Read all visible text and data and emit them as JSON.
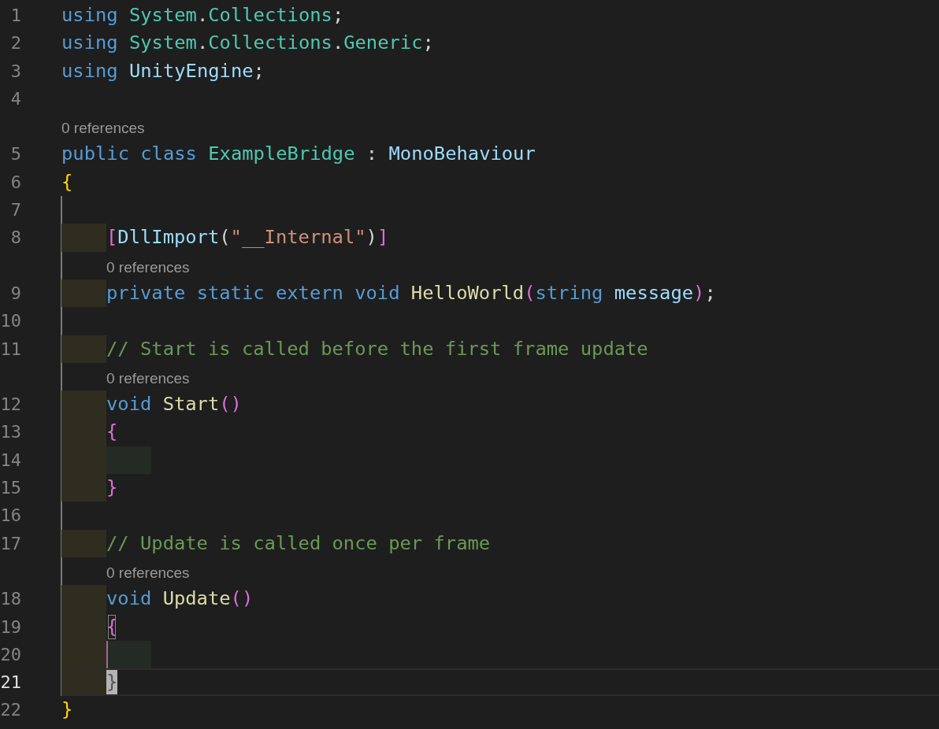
{
  "lines": [
    {
      "kind": "code",
      "number": "1",
      "guide": false,
      "current": false,
      "tokens": [
        {
          "text": "using ",
          "kind": "keyword"
        },
        {
          "text": "System",
          "kind": "type"
        },
        {
          "text": ".",
          "kind": "plain"
        },
        {
          "text": "Collections",
          "kind": "type"
        },
        {
          "text": ";",
          "kind": "plain"
        }
      ]
    },
    {
      "kind": "code",
      "number": "2",
      "guide": false,
      "current": false,
      "tokens": [
        {
          "text": "using ",
          "kind": "keyword"
        },
        {
          "text": "System",
          "kind": "type"
        },
        {
          "text": ".",
          "kind": "plain"
        },
        {
          "text": "Collections",
          "kind": "type"
        },
        {
          "text": ".",
          "kind": "plain"
        },
        {
          "text": "Generic",
          "kind": "type"
        },
        {
          "text": ";",
          "kind": "plain"
        }
      ]
    },
    {
      "kind": "code",
      "number": "3",
      "guide": false,
      "current": false,
      "tokens": [
        {
          "text": "using ",
          "kind": "keyword"
        },
        {
          "text": "UnityEngine",
          "kind": "ident"
        },
        {
          "text": ";",
          "kind": "plain"
        }
      ]
    },
    {
      "kind": "code",
      "number": "4",
      "guide": false,
      "current": false
    },
    {
      "kind": "lens",
      "text": "0 references",
      "nested": false,
      "guide": false
    },
    {
      "kind": "code",
      "number": "5",
      "guide": false,
      "current": false,
      "tokens": [
        {
          "text": "public ",
          "kind": "keyword"
        },
        {
          "text": "class ",
          "kind": "keyword"
        },
        {
          "text": "ExampleBridge",
          "kind": "type"
        },
        {
          "text": " : ",
          "kind": "plain"
        },
        {
          "text": "MonoBehaviour",
          "kind": "ident"
        }
      ]
    },
    {
      "kind": "code",
      "number": "6",
      "guide": false,
      "current": false,
      "tokens": [
        {
          "text": "{",
          "kind": "brace"
        }
      ]
    },
    {
      "kind": "code",
      "number": "7",
      "guide": true,
      "current": false
    },
    {
      "kind": "code",
      "number": "8",
      "guide": true,
      "current": false,
      "indents": [
        {
          "kind": "block"
        }
      ],
      "tokens": [
        {
          "text": "[",
          "kind": "paren"
        },
        {
          "text": "DllImport",
          "kind": "ident"
        },
        {
          "text": "(",
          "kind": "plain"
        },
        {
          "text": "\"__Internal\"",
          "kind": "string"
        },
        {
          "text": ")",
          "kind": "plain"
        },
        {
          "text": "]",
          "kind": "paren"
        }
      ]
    },
    {
      "kind": "lens",
      "text": "0 references",
      "nested": true,
      "guide": true
    },
    {
      "kind": "code",
      "number": "9",
      "guide": true,
      "current": false,
      "indents": [
        {
          "kind": "block"
        }
      ],
      "tokens": [
        {
          "text": "private ",
          "kind": "keyword"
        },
        {
          "text": "static ",
          "kind": "keyword"
        },
        {
          "text": "extern ",
          "kind": "keyword"
        },
        {
          "text": "void ",
          "kind": "keyword"
        },
        {
          "text": "HelloWorld",
          "kind": "method"
        },
        {
          "text": "(",
          "kind": "paren"
        },
        {
          "text": "string ",
          "kind": "keyword"
        },
        {
          "text": "message",
          "kind": "ident"
        },
        {
          "text": ")",
          "kind": "paren"
        },
        {
          "text": ";",
          "kind": "plain"
        }
      ]
    },
    {
      "kind": "code",
      "number": "10",
      "guide": true,
      "current": false
    },
    {
      "kind": "code",
      "number": "11",
      "guide": true,
      "current": false,
      "indents": [
        {
          "kind": "block"
        }
      ],
      "tokens": [
        {
          "text": "// Start is called before the first frame update",
          "kind": "comment"
        }
      ]
    },
    {
      "kind": "lens",
      "text": "0 references",
      "nested": true,
      "guide": true
    },
    {
      "kind": "code",
      "number": "12",
      "guide": true,
      "current": false,
      "indents": [
        {
          "kind": "block"
        }
      ],
      "tokens": [
        {
          "text": "void ",
          "kind": "keyword"
        },
        {
          "text": "Start",
          "kind": "method"
        },
        {
          "text": "()",
          "kind": "paren"
        }
      ]
    },
    {
      "kind": "code",
      "number": "13",
      "guide": true,
      "current": false,
      "indents": [
        {
          "kind": "block"
        }
      ],
      "tokens": [
        {
          "text": "{",
          "kind": "paren"
        }
      ]
    },
    {
      "kind": "code",
      "number": "14",
      "guide": true,
      "current": false,
      "indents": [
        {
          "kind": "block"
        },
        {
          "kind": "inner"
        }
      ]
    },
    {
      "kind": "code",
      "number": "15",
      "guide": true,
      "current": false,
      "indents": [
        {
          "kind": "block"
        }
      ],
      "tokens": [
        {
          "text": "}",
          "kind": "paren"
        }
      ]
    },
    {
      "kind": "code",
      "number": "16",
      "guide": true,
      "current": false
    },
    {
      "kind": "code",
      "number": "17",
      "guide": true,
      "current": false,
      "indents": [
        {
          "kind": "block"
        }
      ],
      "tokens": [
        {
          "text": "// Update is called once per frame",
          "kind": "comment"
        }
      ]
    },
    {
      "kind": "lens",
      "text": "0 references",
      "nested": true,
      "guide": true
    },
    {
      "kind": "code",
      "number": "18",
      "guide": true,
      "current": false,
      "indents": [
        {
          "kind": "block"
        }
      ],
      "tokens": [
        {
          "text": "void ",
          "kind": "keyword"
        },
        {
          "text": "Update",
          "kind": "method"
        },
        {
          "text": "()",
          "kind": "paren"
        }
      ]
    },
    {
      "kind": "code",
      "number": "19",
      "guide": true,
      "current": false,
      "indents": [
        {
          "kind": "block"
        }
      ],
      "tokens": [
        {
          "text": "{",
          "kind": "bracket-match"
        }
      ]
    },
    {
      "kind": "code",
      "number": "20",
      "guide": true,
      "current": false,
      "indents": [
        {
          "kind": "block"
        },
        {
          "kind": "active"
        }
      ]
    },
    {
      "kind": "code",
      "number": "21",
      "guide": true,
      "current": true,
      "indents": [
        {
          "kind": "block"
        }
      ],
      "tokens": [
        {
          "text": "}",
          "kind": "bracket-cursor"
        }
      ]
    },
    {
      "kind": "code",
      "number": "22",
      "guide": false,
      "current": false,
      "tokens": [
        {
          "text": "}",
          "kind": "brace"
        }
      ]
    }
  ]
}
